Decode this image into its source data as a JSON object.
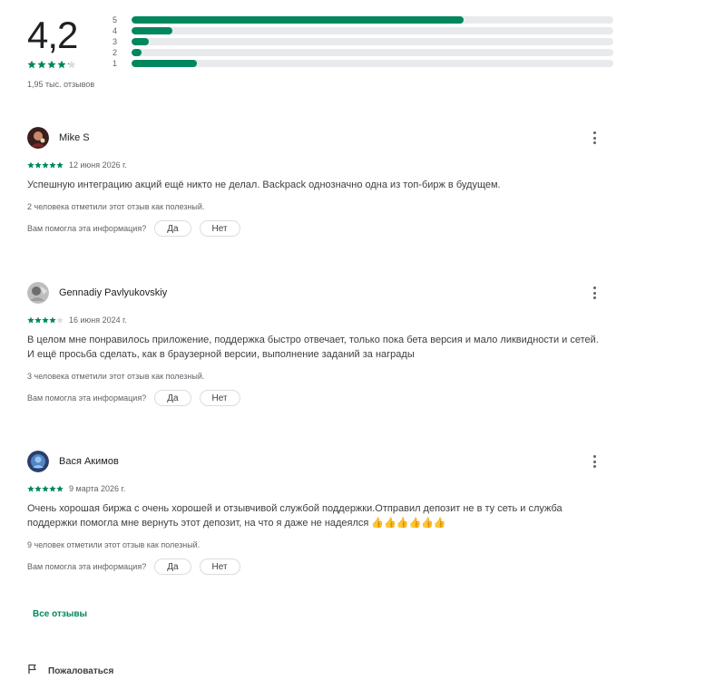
{
  "summary": {
    "score": "4,2",
    "stars": 4.2,
    "review_count": "1,95 тыс. отзывов",
    "accent": "#01875f",
    "distribution": [
      {
        "label": "5",
        "fraction": 0.69
      },
      {
        "label": "4",
        "fraction": 0.085
      },
      {
        "label": "3",
        "fraction": 0.035
      },
      {
        "label": "2",
        "fraction": 0.02
      },
      {
        "label": "1",
        "fraction": 0.135
      }
    ]
  },
  "reviews": [
    {
      "author": "Mike S",
      "stars": 5,
      "date": "12 июня 2026 г.",
      "text": "Успешную интеграцию акций ещё никто не делал. Backpack однозначно одна из топ-бирж в будущем.",
      "helpful_count": "2 человека отметили этот отзыв как полезный.",
      "avatar_color": "#7a2a2a"
    },
    {
      "author": "Gennadiy Pavlyukovskiy",
      "stars": 4,
      "date": "16 июня 2024 г.",
      "text": "В целом мне понравилось приложение, поддержка быстро отвечает, только пока бета версия и мало ликвидности и сетей. И ещё просьба сделать, как в браузерной версии, выполнение заданий за награды",
      "helpful_count": "3 человека отметили этот отзыв как полезный.",
      "avatar_color": "#8a8a8a"
    },
    {
      "author": "Вася Акимов",
      "stars": 5,
      "date": "9 марта 2026 г.",
      "text": "Очень хорошая биржа с очень хорошей и отзывчивой службой поддержки.Отправил депозит не в ту сеть и служба поддержки помогла мне вернуть этот депозит, на что я даже не надеялся 👍👍👍👍👍👍",
      "helpful_count": "9 человек отметили этот отзыв как полезный.",
      "avatar_color": "#3f6fb0"
    }
  ],
  "helpful_question": "Вам помогла эта информация?",
  "yes_label": "Да",
  "no_label": "Нет",
  "all_reviews_label": "Все отзывы",
  "report_label": "Пожаловаться",
  "icons": {
    "more": "more-vert-icon",
    "flag": "flag-icon",
    "star": "star-icon"
  }
}
